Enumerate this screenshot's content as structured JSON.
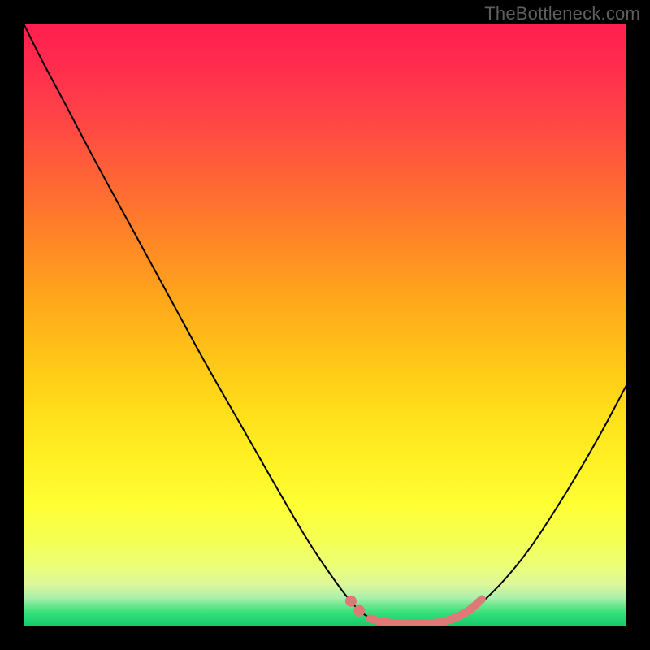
{
  "watermark": "TheBottleneck.com",
  "chart_data": {
    "type": "line",
    "title": "",
    "xlabel": "",
    "ylabel": "",
    "xlim": [
      0,
      100
    ],
    "ylim": [
      0,
      100
    ],
    "grid": false,
    "background_gradient": {
      "stops": [
        {
          "offset": 0.0,
          "color": "#ff1f4f"
        },
        {
          "offset": 0.06,
          "color": "#ff2a4e"
        },
        {
          "offset": 0.15,
          "color": "#ff4247"
        },
        {
          "offset": 0.25,
          "color": "#ff6236"
        },
        {
          "offset": 0.35,
          "color": "#ff8327"
        },
        {
          "offset": 0.45,
          "color": "#ffa51c"
        },
        {
          "offset": 0.55,
          "color": "#ffc317"
        },
        {
          "offset": 0.65,
          "color": "#ffe01a"
        },
        {
          "offset": 0.74,
          "color": "#fff426"
        },
        {
          "offset": 0.8,
          "color": "#feff35"
        },
        {
          "offset": 0.86,
          "color": "#f4ff56"
        },
        {
          "offset": 0.9,
          "color": "#ebff77"
        },
        {
          "offset": 0.93,
          "color": "#def79a"
        },
        {
          "offset": 0.953,
          "color": "#a9efab"
        },
        {
          "offset": 0.965,
          "color": "#6be88f"
        },
        {
          "offset": 0.978,
          "color": "#33e07a"
        },
        {
          "offset": 1.0,
          "color": "#14c96a"
        }
      ]
    },
    "series": [
      {
        "name": "bottleneck-curve",
        "color": "#000000",
        "width": 2,
        "points": [
          {
            "x": 0.0,
            "y": 100.0
          },
          {
            "x": 3.0,
            "y": 94.0
          },
          {
            "x": 7.0,
            "y": 86.5
          },
          {
            "x": 12.0,
            "y": 77.0
          },
          {
            "x": 18.0,
            "y": 66.0
          },
          {
            "x": 24.0,
            "y": 55.0
          },
          {
            "x": 30.0,
            "y": 44.0
          },
          {
            "x": 36.0,
            "y": 33.5
          },
          {
            "x": 42.0,
            "y": 23.0
          },
          {
            "x": 47.0,
            "y": 14.5
          },
          {
            "x": 51.0,
            "y": 8.5
          },
          {
            "x": 54.0,
            "y": 4.5
          },
          {
            "x": 56.5,
            "y": 2.0
          },
          {
            "x": 59.0,
            "y": 0.9
          },
          {
            "x": 62.0,
            "y": 0.4
          },
          {
            "x": 66.0,
            "y": 0.4
          },
          {
            "x": 70.0,
            "y": 0.9
          },
          {
            "x": 73.0,
            "y": 2.0
          },
          {
            "x": 76.0,
            "y": 4.0
          },
          {
            "x": 80.0,
            "y": 8.0
          },
          {
            "x": 84.0,
            "y": 13.0
          },
          {
            "x": 88.0,
            "y": 19.0
          },
          {
            "x": 92.0,
            "y": 25.5
          },
          {
            "x": 96.0,
            "y": 32.5
          },
          {
            "x": 100.0,
            "y": 40.0
          }
        ]
      }
    ],
    "highlight": {
      "color": "#e07878",
      "stroke_width": 10,
      "dots_radius": 7,
      "dots": [
        {
          "x": 54.3,
          "y": 4.2
        },
        {
          "x": 55.7,
          "y": 2.6
        }
      ],
      "segment": [
        {
          "x": 57.5,
          "y": 1.3
        },
        {
          "x": 60.0,
          "y": 0.7
        },
        {
          "x": 64.0,
          "y": 0.4
        },
        {
          "x": 68.0,
          "y": 0.55
        },
        {
          "x": 71.0,
          "y": 1.2
        },
        {
          "x": 73.8,
          "y": 2.6
        },
        {
          "x": 76.0,
          "y": 4.5
        }
      ]
    }
  }
}
